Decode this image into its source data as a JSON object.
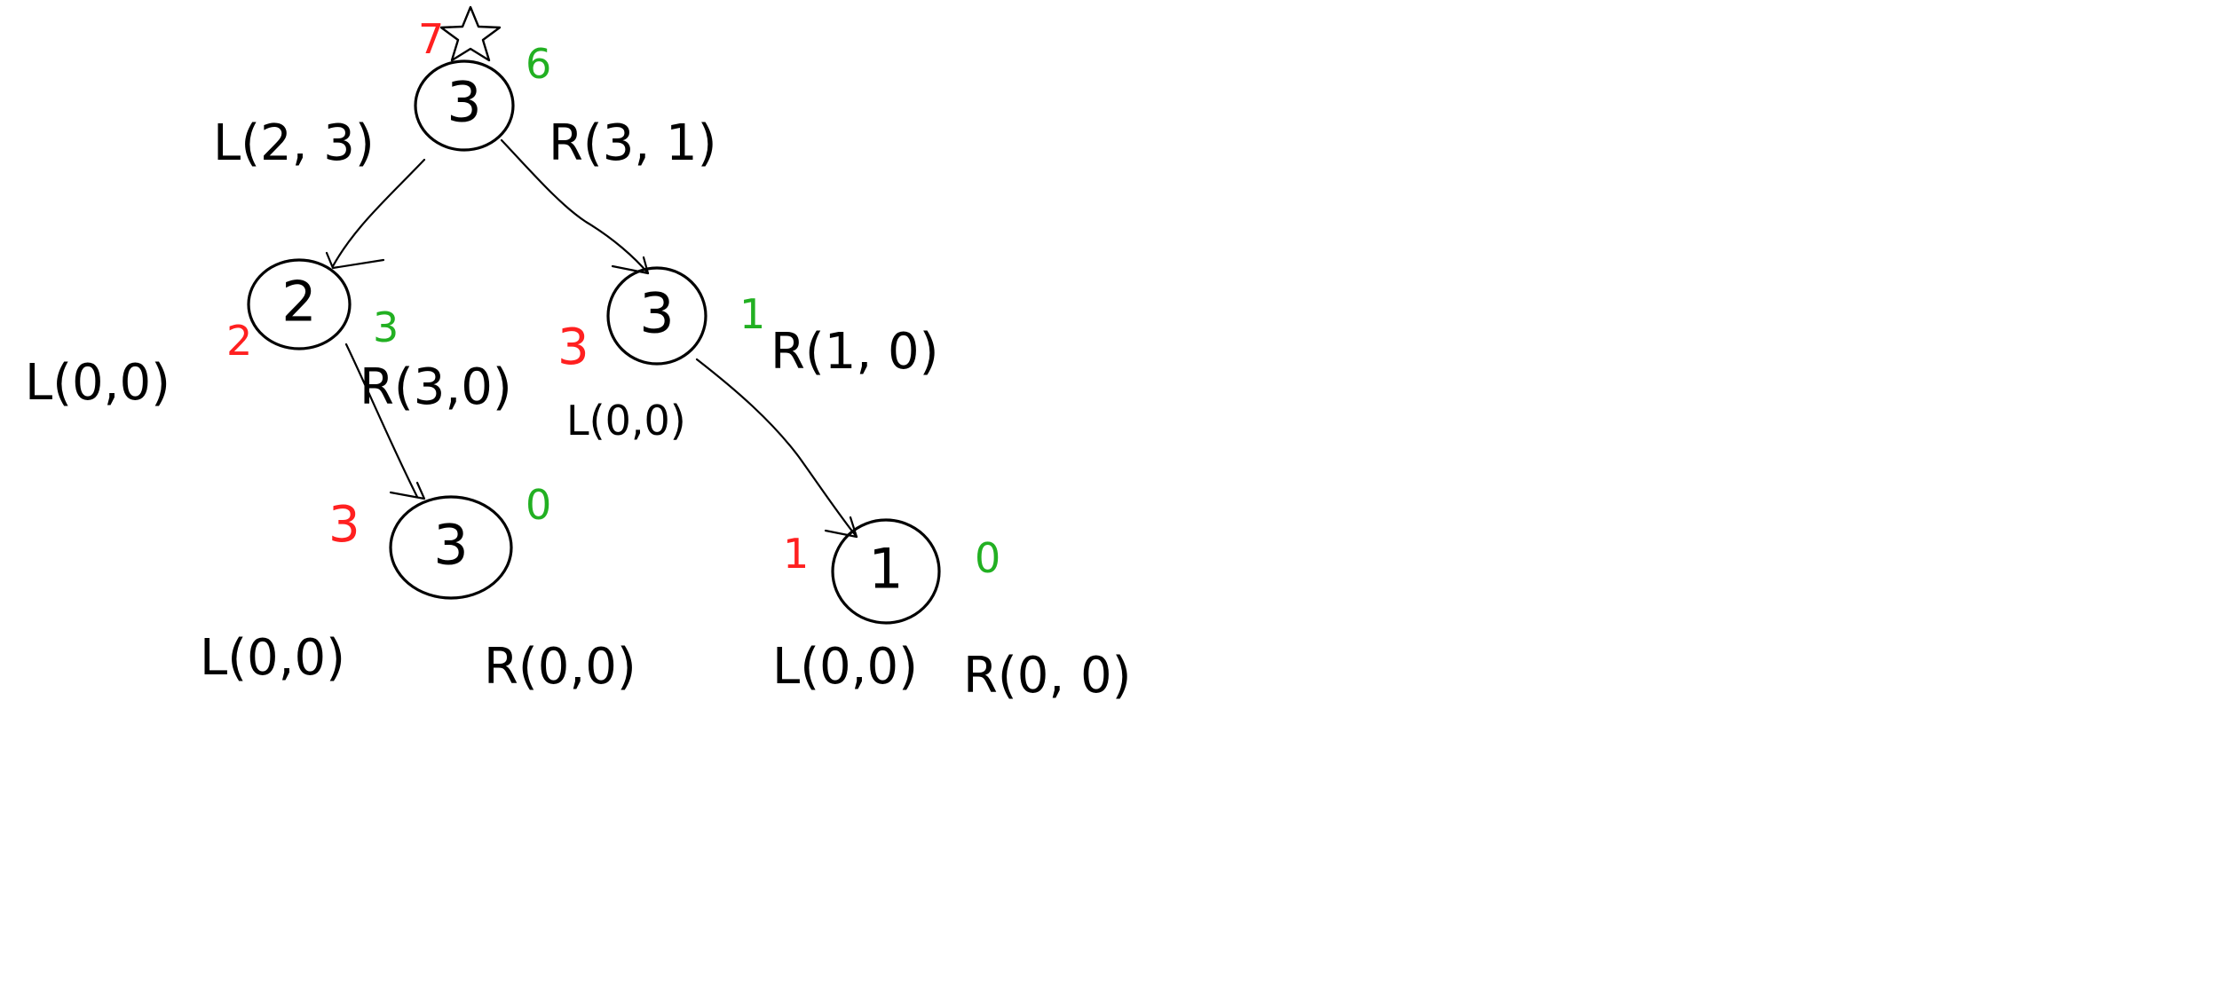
{
  "colors": {
    "ink": "#000000",
    "red": "#ff2020",
    "green": "#22b022"
  },
  "nodes": [
    {
      "id": "root",
      "value": "3",
      "red": "7",
      "green": "6",
      "left_label": "L(2, 3)",
      "right_label": "R(3, 1)"
    },
    {
      "id": "left",
      "value": "2",
      "red": "2",
      "green": "3",
      "left_label": "L(0,0)",
      "right_label": "R(3,0)"
    },
    {
      "id": "right",
      "value": "3",
      "red": "3",
      "green": "1",
      "left_label": "L(0,0)",
      "right_label": "R(1, 0)"
    },
    {
      "id": "left-left",
      "value": "3",
      "red": "3",
      "green": "0",
      "left_label": "L(0,0)",
      "right_label": "R(0,0)"
    },
    {
      "id": "right-right",
      "value": "1",
      "red": "1",
      "green": "0",
      "left_label": "L(0,0)",
      "right_label": "R(0, 0)"
    }
  ],
  "edges": [
    {
      "from": "root",
      "to": "left"
    },
    {
      "from": "root",
      "to": "right"
    },
    {
      "from": "left",
      "to": "left-left"
    },
    {
      "from": "right",
      "to": "right-right"
    }
  ],
  "marker": {
    "icon": "star-icon"
  }
}
